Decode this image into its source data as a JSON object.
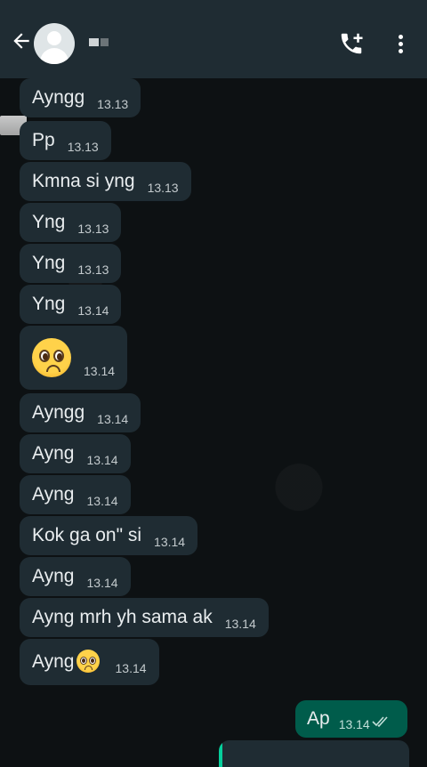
{
  "header": {
    "back_icon": "arrow-left-icon",
    "call_icon": "phone-add-icon",
    "menu_icon": "more-vertical-icon"
  },
  "messages": [
    {
      "text": "Ayngg",
      "time": "13.13"
    },
    {
      "text": "Pp",
      "time": "13.13"
    },
    {
      "text": "Kmna si yng",
      "time": "13.13"
    },
    {
      "text": "Yng",
      "time": "13.13"
    },
    {
      "text": "Yng",
      "time": "13.13"
    },
    {
      "text": "Yng",
      "time": "13.14"
    },
    {
      "text": "",
      "emoji": "pleading-face",
      "time": "13.14"
    },
    {
      "text": "Ayngg",
      "time": "13.14"
    },
    {
      "text": "Ayng",
      "time": "13.14"
    },
    {
      "text": "Ayng",
      "time": "13.14"
    },
    {
      "text": "Kok ga on\" si",
      "time": "13.14"
    },
    {
      "text": "Ayng",
      "time": "13.14"
    },
    {
      "text": "Ayng mrh yh sama ak",
      "time": "13.14"
    },
    {
      "text": "Ayng",
      "emoji": "pleading-face",
      "time": "13.14"
    }
  ],
  "outgoing": {
    "text": "Ap",
    "time": "13.14",
    "status_icon": "double-check-icon"
  },
  "colors": {
    "header": "#1f2c33",
    "incoming": "#1f2c33",
    "outgoing": "#005c4b",
    "accent": "#06cf9c"
  }
}
